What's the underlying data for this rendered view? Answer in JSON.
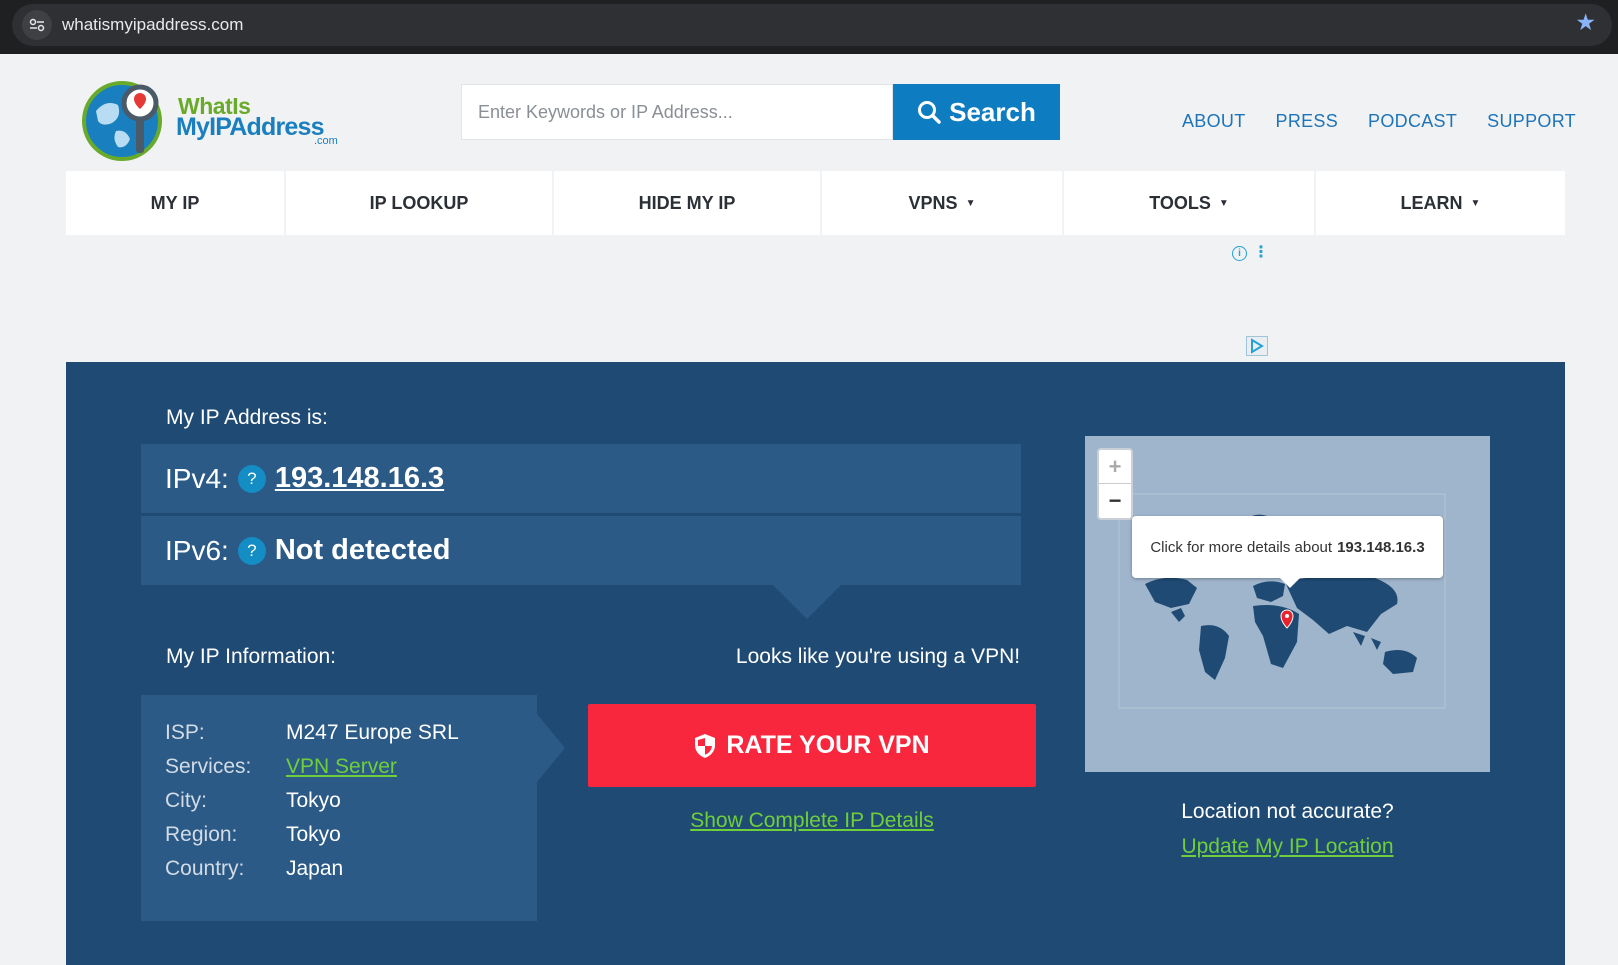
{
  "browser": {
    "url": "whatismyipaddress.com"
  },
  "logo": {
    "line1": "WhatIs",
    "line2": "MyIPAddress",
    "suffix": ".com"
  },
  "search": {
    "placeholder": "Enter Keywords or IP Address...",
    "button_label": "Search"
  },
  "top_links": {
    "about": "ABOUT",
    "press": "PRESS",
    "podcast": "PODCAST",
    "support": "SUPPORT"
  },
  "nav": {
    "my_ip": "MY IP",
    "ip_lookup": "IP LOOKUP",
    "hide_my_ip": "HIDE MY IP",
    "vpns": "VPNS",
    "tools": "TOOLS",
    "learn": "LEARN"
  },
  "main": {
    "ip_heading": "My IP Address is:",
    "ipv4_label": "IPv4:",
    "ipv4_value": "193.148.16.3",
    "ipv6_label": "IPv6:",
    "ipv6_value": "Not detected",
    "help_glyph": "?",
    "info_heading": "My IP Information:",
    "info": {
      "isp_key": "ISP:",
      "isp_val": "M247 Europe SRL",
      "services_key": "Services:",
      "services_val": "VPN Server",
      "city_key": "City:",
      "city_val": "Tokyo",
      "region_key": "Region:",
      "region_val": "Tokyo",
      "country_key": "Country:",
      "country_val": "Japan"
    },
    "vpn_notice": "Looks like you're using a VPN!",
    "rate_button": "RATE YOUR VPN",
    "show_details_link": "Show Complete IP Details",
    "map_tooltip_prefix": "Click for more details about",
    "map_tooltip_ip": "193.148.16.3",
    "location_question": "Location not accurate?",
    "update_location_link": "Update My IP Location"
  },
  "colors": {
    "panel_bg": "#1f4a74",
    "row_bg": "#2b5a86",
    "accent_blue": "#0d7cc1",
    "link_green": "#6fcf3b",
    "cta_red": "#f9273d"
  }
}
